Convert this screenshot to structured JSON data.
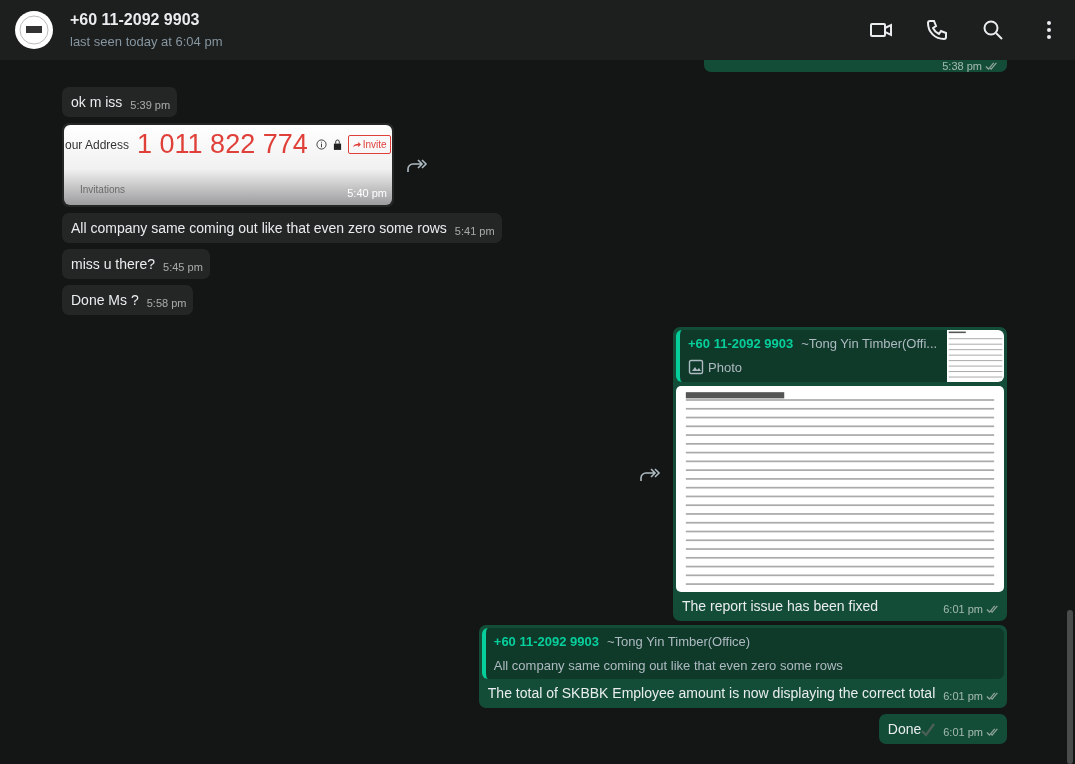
{
  "header": {
    "title": "+60 11-2092 9903",
    "subtitle": "last seen today at 6:04 pm"
  },
  "messages": [
    {
      "kind": "stub",
      "outgoing": true,
      "time": "5:38 pm",
      "read": false
    },
    {
      "kind": "text",
      "outgoing": false,
      "text": "ok m iss",
      "time": "5:39 pm"
    },
    {
      "kind": "screenshot",
      "outgoing": false,
      "forwardable": true,
      "address_label": "our Address",
      "number": "1 011 822 774",
      "button": "Invite",
      "caption": "Invitations",
      "time": "5:40 pm"
    },
    {
      "kind": "text",
      "outgoing": false,
      "text": "All company same coming out like that even zero some rows",
      "time": "5:41 pm"
    },
    {
      "kind": "text",
      "outgoing": false,
      "text": "miss u there?",
      "time": "5:45 pm"
    },
    {
      "kind": "text",
      "outgoing": false,
      "text": "Done Ms ?",
      "time": "5:58 pm"
    },
    {
      "kind": "photo_reply",
      "outgoing": true,
      "forwardable": true,
      "quote": {
        "sender": "+60 11-2092 9903",
        "name": "~Tong Yin Timber(Offi...",
        "text": "Photo"
      },
      "text": "The report issue has been fixed",
      "time": "6:01 pm",
      "read": false
    },
    {
      "kind": "reply",
      "outgoing": true,
      "quote": {
        "sender": "+60 11-2092 9903",
        "name": "~Tong Yin Timber(Office)",
        "text": "All company same coming out like that even zero some rows"
      },
      "text": "The total of SKBBK Employee amount is now displaying the correct total",
      "time": "6:01 pm",
      "read": false
    },
    {
      "kind": "text",
      "outgoing": true,
      "text": "Done",
      "check": true,
      "time": "6:01 pm",
      "read": false
    }
  ]
}
